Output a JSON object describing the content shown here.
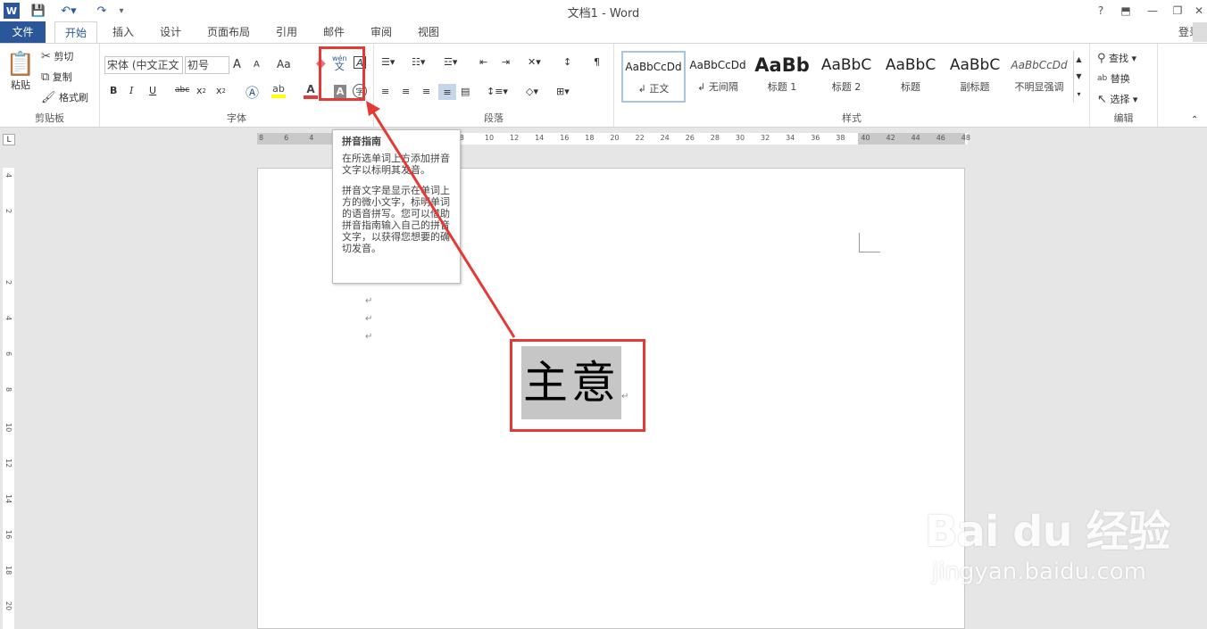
{
  "window": {
    "title": "文档1 - Word",
    "help": "?",
    "restore_ribbon": "⬒",
    "minimize": "—",
    "maximize": "❐",
    "close": "✕"
  },
  "tabs": [
    {
      "label": "文件"
    },
    {
      "label": "开始"
    },
    {
      "label": "插入"
    },
    {
      "label": "设计"
    },
    {
      "label": "页面布局"
    },
    {
      "label": "引用"
    },
    {
      "label": "邮件"
    },
    {
      "label": "审阅"
    },
    {
      "label": "视图"
    }
  ],
  "login": "登录",
  "clipboard": {
    "paste": "粘贴",
    "cut": "剪切",
    "copy": "复制",
    "format_painter": "格式刷",
    "group_label": "剪贴板"
  },
  "font": {
    "font_name": "宋体 (中文正文",
    "font_size": "初号",
    "grow": "A",
    "shrink": "A",
    "case": "Aa",
    "bold": "B",
    "italic": "I",
    "underline": "U",
    "strike": "abc",
    "sub": "x",
    "sup": "x",
    "highlight_color": "#ffff00",
    "font_color": "#e53935",
    "group_label": "字体",
    "phonetic_top": "wén",
    "phonetic_bottom": "文",
    "char_border": "A",
    "char_shading": "A",
    "enclose": "字"
  },
  "paragraph": {
    "group_label": "段落"
  },
  "styles": {
    "items": [
      {
        "sample": "AaBbCcDd",
        "name": "↲ 正文"
      },
      {
        "sample": "AaBbCcDd",
        "name": "↲ 无间隔"
      },
      {
        "sample": "AaBb",
        "name": "标题 1"
      },
      {
        "sample": "AaBbC",
        "name": "标题 2"
      },
      {
        "sample": "AaBbC",
        "name": "标题"
      },
      {
        "sample": "AaBbC",
        "name": "副标题"
      },
      {
        "sample": "AaBbCcDd",
        "name": "不明显强调"
      }
    ],
    "group_label": "样式"
  },
  "editing": {
    "find": "查找",
    "replace": "替换",
    "select": "选择",
    "group_label": "编辑"
  },
  "ruler": {
    "horizontal": [
      "8",
      "6",
      "4",
      "2",
      "",
      "2",
      "4",
      "6",
      "8",
      "10",
      "12",
      "14",
      "16",
      "18",
      "20",
      "22",
      "24",
      "26",
      "28",
      "30",
      "32",
      "34",
      "36",
      "38",
      "40",
      "42",
      "44",
      "46",
      "48"
    ],
    "vertical": [
      "4",
      "2",
      "",
      "2",
      "4",
      "6",
      "8",
      "10",
      "12",
      "14",
      "16",
      "18",
      "20"
    ],
    "corner": "L"
  },
  "tooltip": {
    "title": "拼音指南",
    "p1": "在所选单词上方添加拼音文字以标明其发音。",
    "p2": "拼音文字是显示在单词上方的微小文字，标明单词的语音拼写。您可以借助拼音指南输入自己的拼音文字，以获得您想要的确切发音。"
  },
  "document": {
    "selected_text": "主意",
    "paragraph_mark": "↵"
  },
  "watermark": {
    "logo": "Bai du 经验",
    "url": "jingyan.baidu.com"
  }
}
